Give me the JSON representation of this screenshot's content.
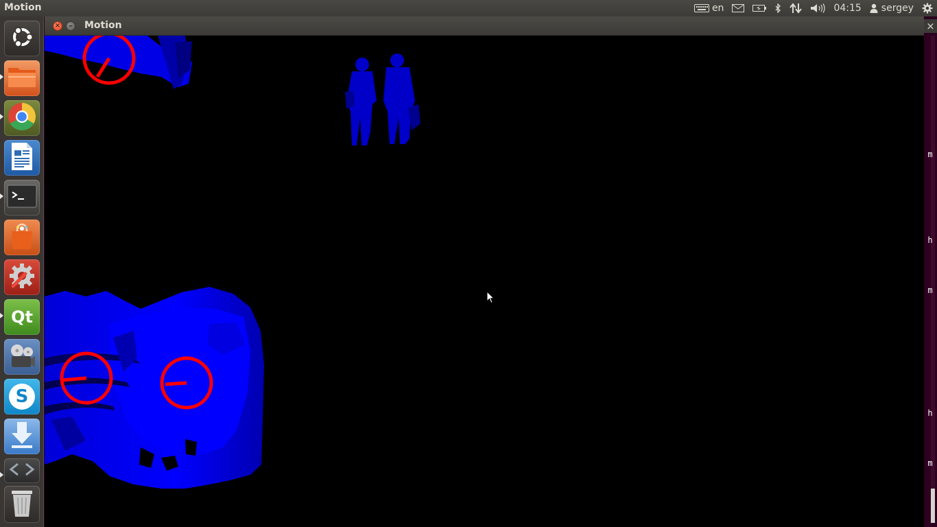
{
  "top_panel": {
    "app_name": "Motion",
    "keyboard_layout": "en",
    "clock": "04:15",
    "user": "sergey",
    "icons": [
      "keyboard-icon",
      "mail-icon",
      "battery-icon",
      "bluetooth-icon",
      "network-icon",
      "volume-icon",
      "user-icon",
      "gear-icon"
    ]
  },
  "launcher": {
    "items": [
      {
        "name": "dash-home",
        "icon": "ubuntu-logo-icon"
      },
      {
        "name": "files",
        "icon": "folder-icon"
      },
      {
        "name": "chrome",
        "icon": "chrome-icon"
      },
      {
        "name": "libreoffice-writer",
        "icon": "document-icon"
      },
      {
        "name": "terminal",
        "icon": "terminal-icon"
      },
      {
        "name": "software-center",
        "icon": "shopping-bag-icon"
      },
      {
        "name": "system-settings",
        "icon": "wrench-gear-icon"
      },
      {
        "name": "qt-creator",
        "icon": "qt-icon"
      },
      {
        "name": "video-editor",
        "icon": "film-reel-icon"
      },
      {
        "name": "skype",
        "icon": "skype-icon"
      },
      {
        "name": "downloader",
        "icon": "download-arrow-icon"
      },
      {
        "name": "code-editor",
        "icon": "brackets-icon"
      },
      {
        "name": "trash",
        "icon": "trash-icon"
      }
    ],
    "qt_label": "Qt",
    "skype_label": "S"
  },
  "window": {
    "title": "Motion",
    "close_glyph": "×",
    "minimize_glyph": "–"
  },
  "motion_view": {
    "background": "#000000",
    "foreground_color": "#0000ff",
    "marker_color": "#ff0000",
    "markers": [
      {
        "id": "top-left",
        "direction_deg": 240
      },
      {
        "id": "bottom-left",
        "direction_deg": 180
      },
      {
        "id": "bottom-middle",
        "direction_deg": 180
      }
    ]
  },
  "background_terminal": {
    "close_glyph": "×",
    "chars": [
      "m",
      "h",
      "m",
      "h",
      "m"
    ],
    "accent": "#2c001e"
  }
}
